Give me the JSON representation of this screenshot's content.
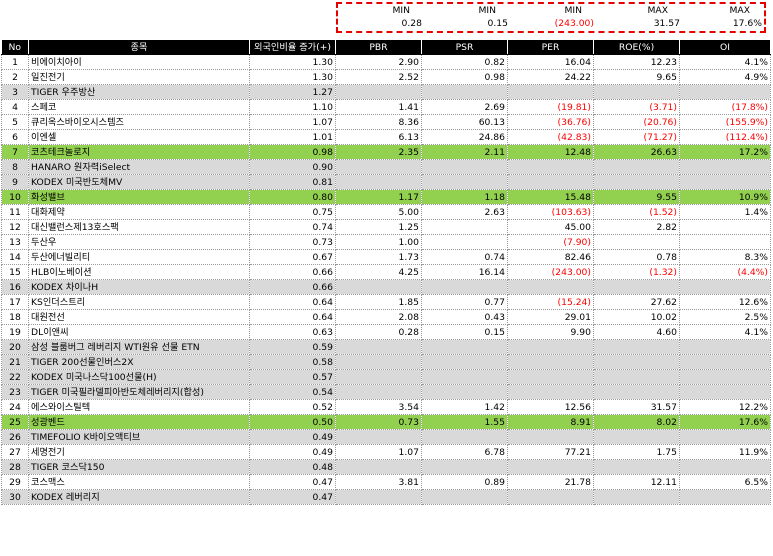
{
  "summary": {
    "labels": [
      "MIN",
      "MIN",
      "MIN",
      "MAX",
      "MAX"
    ],
    "values": [
      "0.28",
      "0.15",
      "(243.00)",
      "31.57",
      "17.6%"
    ],
    "negative": [
      false,
      false,
      true,
      false,
      false
    ]
  },
  "columns": [
    "No",
    "종목",
    "외국인비율 증가(+)",
    "PBR",
    "PSR",
    "PER",
    "ROE(%)",
    "OI"
  ],
  "rows": [
    {
      "no": "1",
      "name": "비에이치아이",
      "foreign": "1.30",
      "pbr": "2.90",
      "psr": "0.82",
      "per": "16.04",
      "roe": "12.23",
      "oi": "4.1%",
      "style": "normal",
      "neg": []
    },
    {
      "no": "2",
      "name": "일진전기",
      "foreign": "1.30",
      "pbr": "2.52",
      "psr": "0.98",
      "per": "24.22",
      "roe": "9.65",
      "oi": "4.9%",
      "style": "normal",
      "neg": []
    },
    {
      "no": "3",
      "name": "TIGER 우주방산",
      "foreign": "1.27",
      "pbr": "",
      "psr": "",
      "per": "",
      "roe": "",
      "oi": "",
      "style": "etf",
      "neg": []
    },
    {
      "no": "4",
      "name": "스페코",
      "foreign": "1.10",
      "pbr": "1.41",
      "psr": "2.69",
      "per": "(19.81)",
      "roe": "(3.71)",
      "oi": "(17.8%)",
      "style": "normal",
      "neg": [
        "per",
        "roe",
        "oi"
      ]
    },
    {
      "no": "5",
      "name": "큐리옥스바이오시스템즈",
      "foreign": "1.07",
      "pbr": "8.36",
      "psr": "60.13",
      "per": "(36.76)",
      "roe": "(20.76)",
      "oi": "(155.9%)",
      "style": "normal",
      "neg": [
        "per",
        "roe",
        "oi"
      ]
    },
    {
      "no": "6",
      "name": "이엔셀",
      "foreign": "1.01",
      "pbr": "6.13",
      "psr": "24.86",
      "per": "(42.83)",
      "roe": "(71.27)",
      "oi": "(112.4%)",
      "style": "normal",
      "neg": [
        "per",
        "roe",
        "oi"
      ]
    },
    {
      "no": "7",
      "name": "코츠테크놀로지",
      "foreign": "0.98",
      "pbr": "2.35",
      "psr": "2.11",
      "per": "12.48",
      "roe": "26.63",
      "oi": "17.2%",
      "style": "hl",
      "neg": []
    },
    {
      "no": "8",
      "name": "HANARO 원자력iSelect",
      "foreign": "0.90",
      "pbr": "",
      "psr": "",
      "per": "",
      "roe": "",
      "oi": "",
      "style": "etf",
      "neg": []
    },
    {
      "no": "9",
      "name": "KODEX 미국반도체MV",
      "foreign": "0.81",
      "pbr": "",
      "psr": "",
      "per": "",
      "roe": "",
      "oi": "",
      "style": "etf",
      "neg": []
    },
    {
      "no": "10",
      "name": "화성밸브",
      "foreign": "0.80",
      "pbr": "1.17",
      "psr": "1.18",
      "per": "15.48",
      "roe": "9.55",
      "oi": "10.9%",
      "style": "hl",
      "neg": []
    },
    {
      "no": "11",
      "name": "대화제약",
      "foreign": "0.75",
      "pbr": "5.00",
      "psr": "2.63",
      "per": "(103.63)",
      "roe": "(1.52)",
      "oi": "1.4%",
      "style": "normal",
      "neg": [
        "per",
        "roe"
      ]
    },
    {
      "no": "12",
      "name": "대신밸런스제13호스팩",
      "foreign": "0.74",
      "pbr": "1.25",
      "psr": "",
      "per": "45.00",
      "roe": "2.82",
      "oi": "",
      "style": "normal",
      "neg": []
    },
    {
      "no": "13",
      "name": "두산우",
      "foreign": "0.73",
      "pbr": "1.00",
      "psr": "",
      "per": "(7.90)",
      "roe": "",
      "oi": "",
      "style": "normal",
      "neg": [
        "per"
      ]
    },
    {
      "no": "14",
      "name": "두산에너빌리티",
      "foreign": "0.67",
      "pbr": "1.73",
      "psr": "0.74",
      "per": "82.46",
      "roe": "0.78",
      "oi": "8.3%",
      "style": "normal",
      "neg": []
    },
    {
      "no": "15",
      "name": "HLB이노베이션",
      "foreign": "0.66",
      "pbr": "4.25",
      "psr": "16.14",
      "per": "(243.00)",
      "roe": "(1.32)",
      "oi": "(4.4%)",
      "style": "normal",
      "neg": [
        "per",
        "roe",
        "oi"
      ]
    },
    {
      "no": "16",
      "name": "KODEX 차이나H",
      "foreign": "0.66",
      "pbr": "",
      "psr": "",
      "per": "",
      "roe": "",
      "oi": "",
      "style": "etf",
      "neg": []
    },
    {
      "no": "17",
      "name": "KS인더스트리",
      "foreign": "0.64",
      "pbr": "1.85",
      "psr": "0.77",
      "per": "(15.24)",
      "roe": "27.62",
      "oi": "12.6%",
      "style": "normal",
      "neg": [
        "per"
      ]
    },
    {
      "no": "18",
      "name": "대원전선",
      "foreign": "0.64",
      "pbr": "2.08",
      "psr": "0.43",
      "per": "29.01",
      "roe": "10.02",
      "oi": "2.5%",
      "style": "normal",
      "neg": []
    },
    {
      "no": "19",
      "name": "DL이앤씨",
      "foreign": "0.63",
      "pbr": "0.28",
      "psr": "0.15",
      "per": "9.90",
      "roe": "4.60",
      "oi": "4.1%",
      "style": "normal",
      "neg": []
    },
    {
      "no": "20",
      "name": "삼성 블룸버그 레버리지 WTI원유 선물 ETN",
      "foreign": "0.59",
      "pbr": "",
      "psr": "",
      "per": "",
      "roe": "",
      "oi": "",
      "style": "etf",
      "neg": []
    },
    {
      "no": "21",
      "name": "TIGER 200선물인버스2X",
      "foreign": "0.58",
      "pbr": "",
      "psr": "",
      "per": "",
      "roe": "",
      "oi": "",
      "style": "etf",
      "neg": []
    },
    {
      "no": "22",
      "name": "KODEX 미국나스닥100선물(H)",
      "foreign": "0.57",
      "pbr": "",
      "psr": "",
      "per": "",
      "roe": "",
      "oi": "",
      "style": "etf",
      "neg": []
    },
    {
      "no": "23",
      "name": "TIGER 미국필라델피아반도체레버리지(합성)",
      "foreign": "0.54",
      "pbr": "",
      "psr": "",
      "per": "",
      "roe": "",
      "oi": "",
      "style": "etf",
      "neg": []
    },
    {
      "no": "24",
      "name": "에스와이스틸텍",
      "foreign": "0.52",
      "pbr": "3.54",
      "psr": "1.42",
      "per": "12.56",
      "roe": "31.57",
      "oi": "12.2%",
      "style": "normal",
      "neg": []
    },
    {
      "no": "25",
      "name": "성광벤드",
      "foreign": "0.50",
      "pbr": "0.73",
      "psr": "1.55",
      "per": "8.91",
      "roe": "8.02",
      "oi": "17.6%",
      "style": "hl",
      "neg": []
    },
    {
      "no": "26",
      "name": "TIMEFOLIO K바이오액티브",
      "foreign": "0.49",
      "pbr": "",
      "psr": "",
      "per": "",
      "roe": "",
      "oi": "",
      "style": "etf",
      "neg": []
    },
    {
      "no": "27",
      "name": "세명전기",
      "foreign": "0.49",
      "pbr": "1.07",
      "psr": "6.78",
      "per": "77.21",
      "roe": "1.75",
      "oi": "11.9%",
      "style": "normal",
      "neg": []
    },
    {
      "no": "28",
      "name": "TIGER 코스닥150",
      "foreign": "0.48",
      "pbr": "",
      "psr": "",
      "per": "",
      "roe": "",
      "oi": "",
      "style": "etf",
      "neg": []
    },
    {
      "no": "29",
      "name": "코스맥스",
      "foreign": "0.47",
      "pbr": "3.81",
      "psr": "0.89",
      "per": "21.78",
      "roe": "12.11",
      "oi": "6.5%",
      "style": "normal",
      "neg": []
    },
    {
      "no": "30",
      "name": "KODEX 레버리지",
      "foreign": "0.47",
      "pbr": "",
      "psr": "",
      "per": "",
      "roe": "",
      "oi": "",
      "style": "etf",
      "neg": []
    }
  ]
}
